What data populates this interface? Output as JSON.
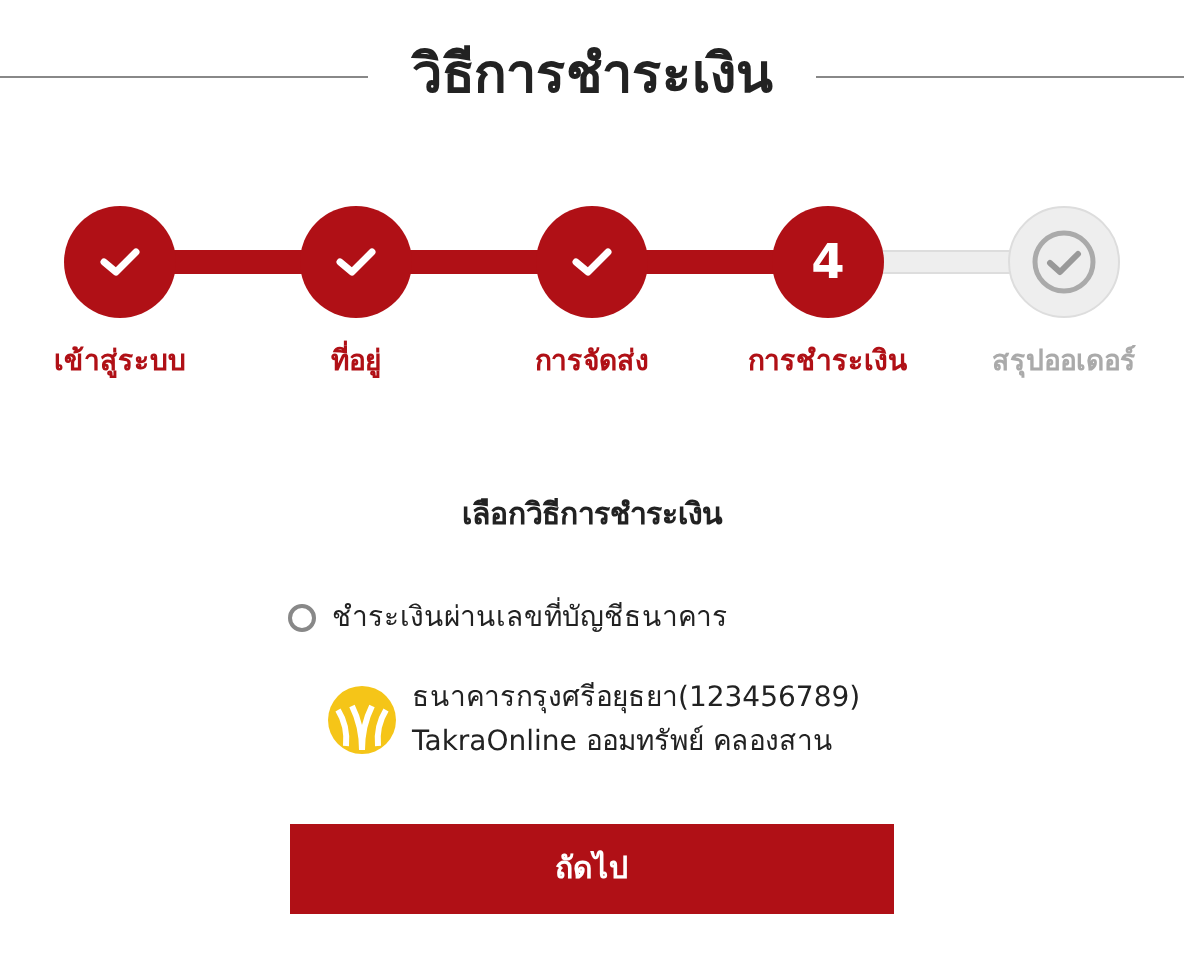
{
  "title": "วิธีการชำระเงิน",
  "steps": [
    {
      "label": "เข้าสู่ระบบ",
      "kind": "done"
    },
    {
      "label": "ที่อยู่",
      "kind": "done"
    },
    {
      "label": "การจัดส่ง",
      "kind": "done"
    },
    {
      "label": "การชำระเงิน",
      "kind": "current",
      "number": "4"
    },
    {
      "label": "สรุปออเดอร์",
      "kind": "pending"
    }
  ],
  "payment": {
    "heading": "เลือกวิธีการชำระเงิน",
    "options": [
      {
        "label": "ชำระเงินผ่านเลขที่บัญชีธนาคาร",
        "selected": false,
        "banks": [
          {
            "name": "ธนาคารกรุงศรีอยุธยา(123456789)",
            "account": "TakraOnline ออมทรัพย์ คลองสาน"
          }
        ]
      }
    ]
  },
  "button": "ถัดไป"
}
